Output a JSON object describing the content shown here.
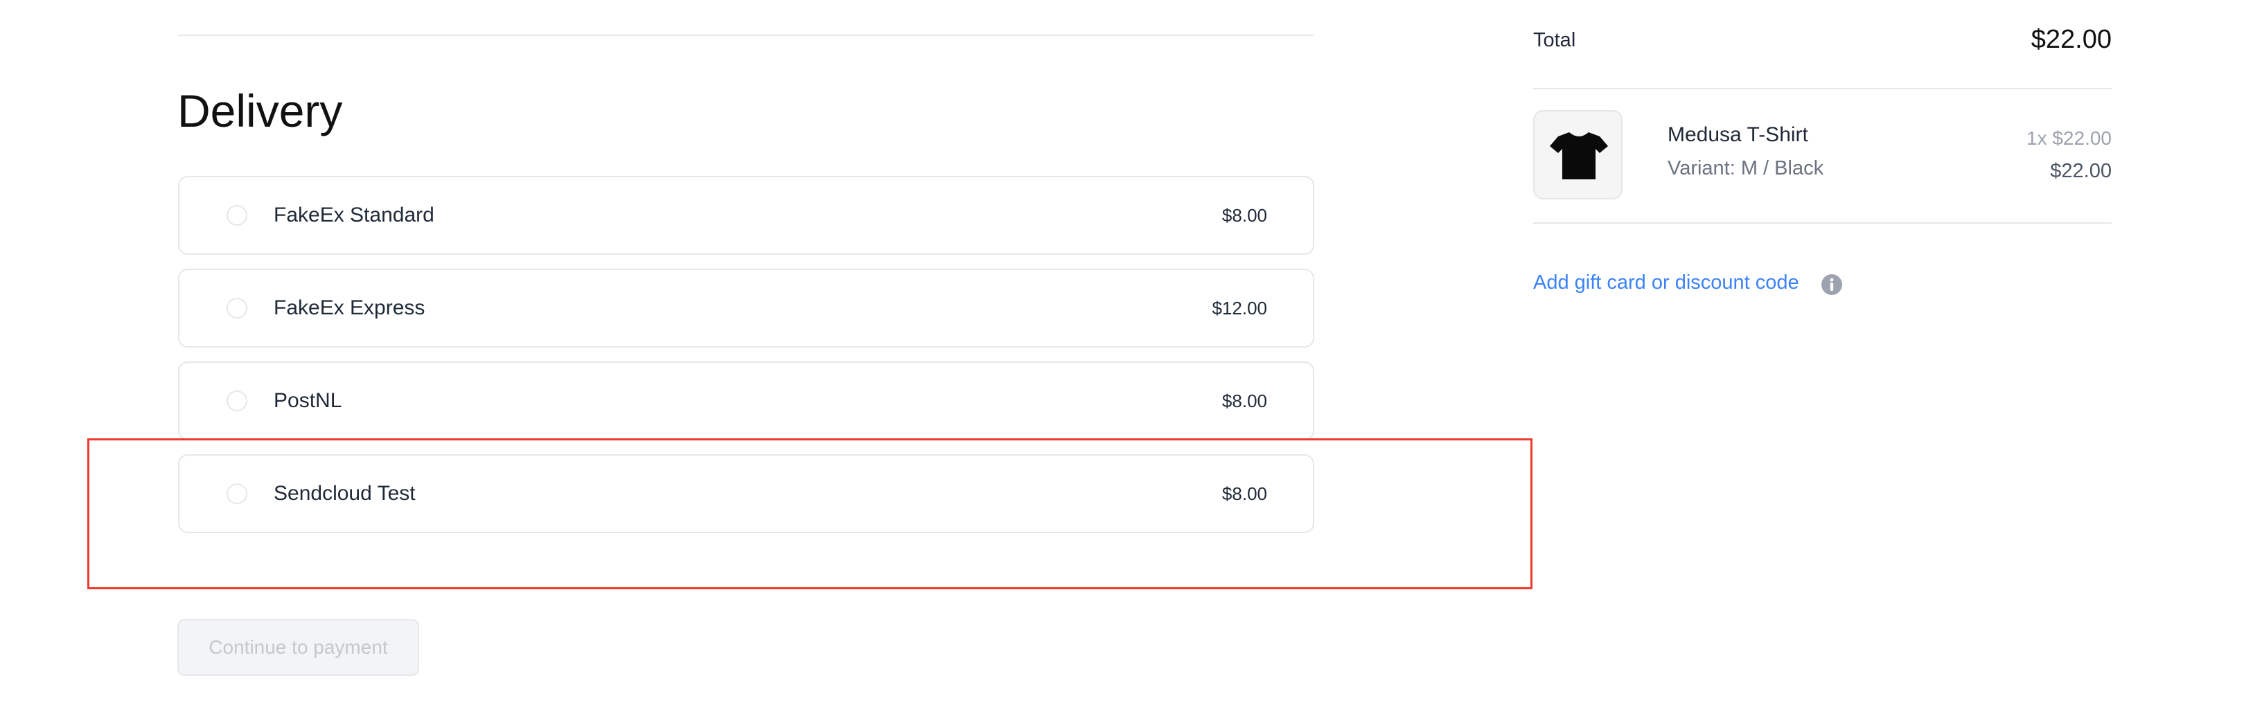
{
  "delivery": {
    "title": "Delivery",
    "options": [
      {
        "name": "FakeEx Standard",
        "price": "$8.00"
      },
      {
        "name": "FakeEx Express",
        "price": "$12.00"
      },
      {
        "name": "PostNL",
        "price": "$8.00"
      },
      {
        "name": "Sendcloud Test",
        "price": "$8.00"
      }
    ],
    "continue_label": "Continue to payment",
    "highlight_color": "#ef3b2d"
  },
  "summary": {
    "total_label": "Total",
    "total_amount": "$22.00",
    "item": {
      "name": "Medusa T-Shirt",
      "variant": "Variant: M / Black",
      "quantity_price": "1x $22.00",
      "line_total": "$22.00",
      "thumbnail_icon": "tshirt-icon"
    },
    "gift_card_label": "Add gift card or discount code",
    "link_color": "#3b82f6"
  }
}
